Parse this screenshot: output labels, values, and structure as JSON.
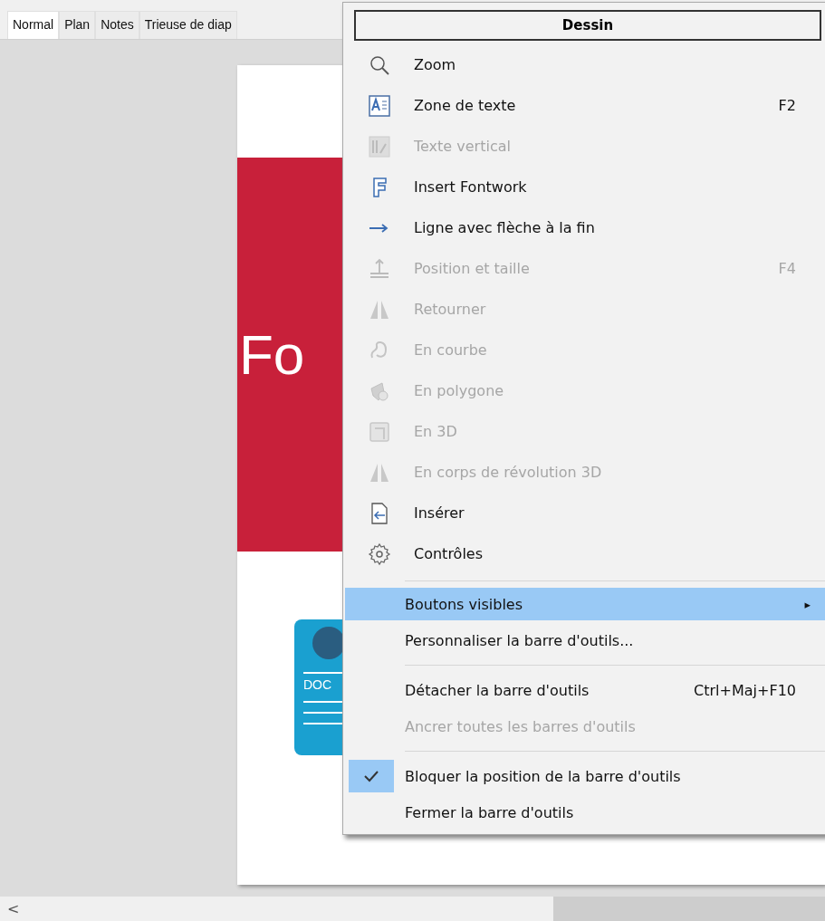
{
  "tabs": [
    {
      "label": "Normal",
      "selected": true
    },
    {
      "label": "Plan",
      "selected": false
    },
    {
      "label": "Notes",
      "selected": false
    },
    {
      "label": "Trieuse de diap",
      "selected": false
    }
  ],
  "slide": {
    "title_text": "Fo",
    "card_text": "DOC"
  },
  "scrollbar": {
    "arrow": "<"
  },
  "menu": {
    "title": "Dessin",
    "items": [
      {
        "kind": "item",
        "label": "Zoom",
        "disabled": false,
        "highlighted": false,
        "checked": false
      },
      {
        "kind": "item",
        "label": "Zone de texte",
        "shortcut": "F2",
        "disabled": false,
        "highlighted": false,
        "checked": false
      },
      {
        "kind": "item",
        "label": "Texte vertical",
        "disabled": true,
        "highlighted": false,
        "checked": false
      },
      {
        "kind": "item",
        "label": "Insert Fontwork",
        "disabled": false,
        "highlighted": false,
        "checked": false
      },
      {
        "kind": "item",
        "label": "Ligne avec flèche à la fin",
        "disabled": false,
        "highlighted": false,
        "checked": false
      },
      {
        "kind": "item",
        "label": "Position et taille",
        "shortcut": "F4",
        "disabled": true,
        "highlighted": false,
        "checked": false
      },
      {
        "kind": "item",
        "label": "Retourner",
        "disabled": true,
        "highlighted": false,
        "checked": false
      },
      {
        "kind": "item",
        "label": "En courbe",
        "disabled": true,
        "highlighted": false,
        "checked": false
      },
      {
        "kind": "item",
        "label": "En polygone",
        "disabled": true,
        "highlighted": false,
        "checked": false
      },
      {
        "kind": "item",
        "label": "En 3D",
        "disabled": true,
        "highlighted": false,
        "checked": false
      },
      {
        "kind": "item",
        "label": "En corps de révolution 3D",
        "disabled": true,
        "highlighted": false,
        "checked": false
      },
      {
        "kind": "item",
        "label": "Insérer",
        "disabled": false,
        "highlighted": false,
        "checked": false
      },
      {
        "kind": "item",
        "label": "Contrôles",
        "disabled": false,
        "highlighted": false,
        "checked": false
      },
      {
        "kind": "separator"
      },
      {
        "kind": "submenu",
        "label": "Boutons visibles",
        "submenu_arrow": "▸",
        "disabled": false,
        "highlighted": true,
        "checked": false
      },
      {
        "kind": "item",
        "label": "Personnaliser la barre d'outils...",
        "disabled": false,
        "highlighted": false,
        "checked": false
      },
      {
        "kind": "separator"
      },
      {
        "kind": "item",
        "label": "Détacher la barre d'outils",
        "shortcut": "Ctrl+Maj+F10",
        "disabled": false,
        "highlighted": false,
        "checked": false
      },
      {
        "kind": "item",
        "label": "Ancrer toutes les barres d'outils",
        "disabled": true,
        "highlighted": false,
        "checked": false
      },
      {
        "kind": "separator"
      },
      {
        "kind": "item",
        "label": "Bloquer la position de la barre d'outils",
        "disabled": false,
        "highlighted": false,
        "checked": true
      },
      {
        "kind": "item",
        "label": "Fermer la barre d'outils",
        "disabled": false,
        "highlighted": false,
        "checked": false
      }
    ]
  }
}
